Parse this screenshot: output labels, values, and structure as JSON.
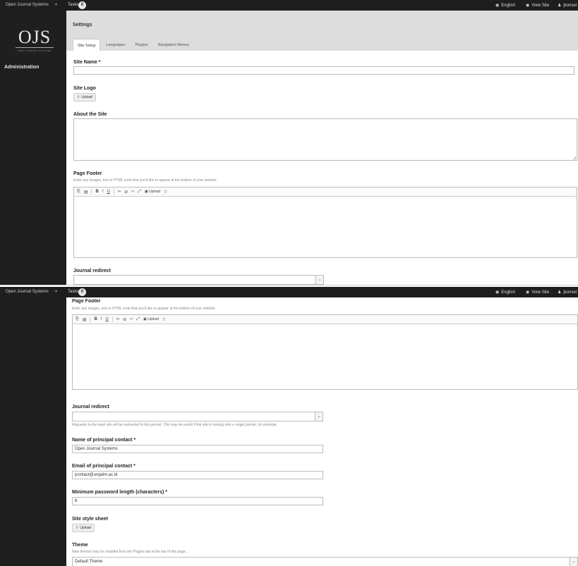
{
  "topbar": {
    "brand": "Open Journal Systems",
    "tasks_label": "Tasks",
    "tasks_count": "0",
    "language": "English",
    "view_site": "View Site",
    "user": "jkonsel"
  },
  "sidebar": {
    "logo_big": "OJS",
    "logo_small": "OPEN JOURNAL SYSTEMS",
    "admin_label": "Administration"
  },
  "header": {
    "title": "Settings",
    "tabs": [
      "Site Setup",
      "Languages",
      "Plugins",
      "Navigation Menus"
    ]
  },
  "form": {
    "site_name_label": "Site Name *",
    "site_name_value": "",
    "site_logo_label": "Site Logo",
    "upload_label": "Upload",
    "about_label": "About the Site",
    "footer_label": "Page Footer",
    "footer_desc": "Enter any images, text or HTML code that you'd like to appear at the bottom of your website.",
    "toolbar_upload": "Upload",
    "redirect_label": "Journal redirect",
    "redirect_value": "",
    "redirect_desc": "Requests to the main site will be redirected to this journal. This may be useful if the site is hosting only a single journal, for example.",
    "contact_name_label": "Name of principal contact *",
    "contact_name_value": "Open Journal Systems",
    "contact_email_label": "Email of principal contact *",
    "contact_email_value": "jcontact@unjatim.ac.id",
    "min_pw_label": "Minimum password length (characters) *",
    "min_pw_value": "6",
    "stylesheet_label": "Site style sheet",
    "stylesheet_upload": "Upload",
    "theme_label": "Theme",
    "theme_desc": "New themes may be installed from the Plugins tab at the top of this page.",
    "theme_value": "Default Theme"
  }
}
